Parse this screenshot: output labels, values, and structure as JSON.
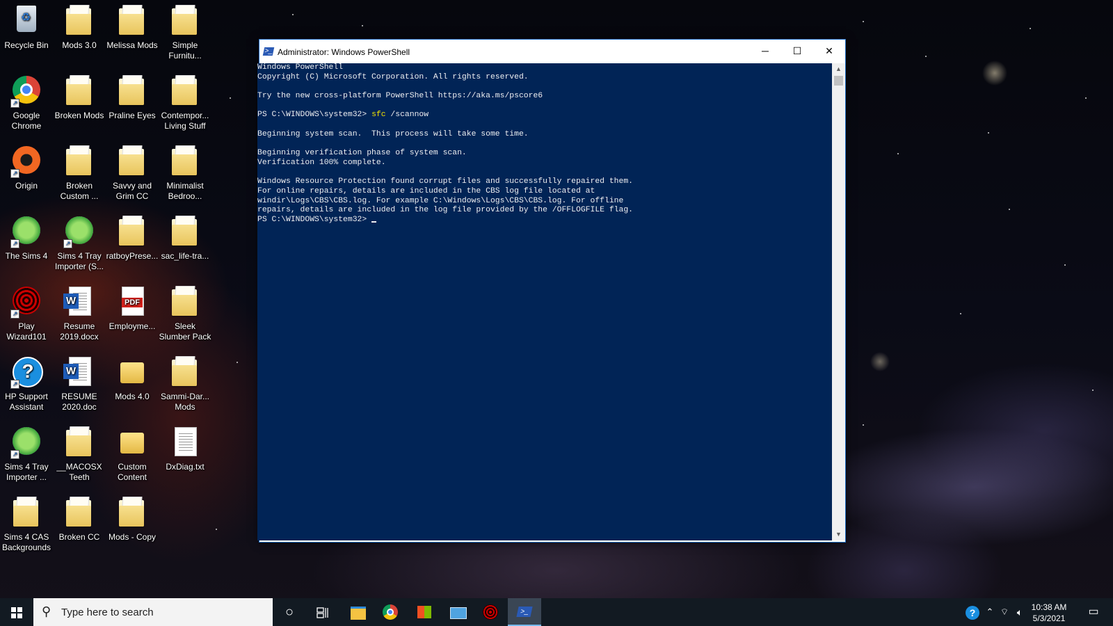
{
  "desktop": {
    "icons": [
      {
        "label": "Recycle Bin"
      },
      {
        "label": "Mods 3.0"
      },
      {
        "label": "Melissa Mods"
      },
      {
        "label": "Simple\nFurnitu..."
      },
      {
        "label": "Google\nChrome"
      },
      {
        "label": "Broken Mods"
      },
      {
        "label": "Praline Eyes"
      },
      {
        "label": "Contempor...\nLiving Stuff"
      },
      {
        "label": "Origin"
      },
      {
        "label": "Broken\nCustom ..."
      },
      {
        "label": "Savvy and\nGrim CC"
      },
      {
        "label": "Minimalist\nBedroo..."
      },
      {
        "label": "The Sims 4"
      },
      {
        "label": "Sims 4 Tray\nImporter (S..."
      },
      {
        "label": "ratboyPrese..."
      },
      {
        "label": "sac_life-tra..."
      },
      {
        "label": "Play\nWizard101"
      },
      {
        "label": "Resume\n2019.docx"
      },
      {
        "label": "Employme..."
      },
      {
        "label": "Sleek\nSlumber Pack"
      },
      {
        "label": "HP Support\nAssistant"
      },
      {
        "label": "RESUME\n2020.doc"
      },
      {
        "label": "Mods 4.0"
      },
      {
        "label": "Sammi-Dar...\nMods"
      },
      {
        "label": "Sims 4 Tray\nImporter ..."
      },
      {
        "label": "__MACOSX\nTeeth"
      },
      {
        "label": "Custom\nContent"
      },
      {
        "label": "DxDiag.txt"
      },
      {
        "label": "Sims 4 CAS\nBackgrounds"
      },
      {
        "label": "Broken CC"
      },
      {
        "label": "Mods - Copy"
      }
    ]
  },
  "window": {
    "title": "Administrator: Windows PowerShell",
    "minimize": "─",
    "maximize": "☐",
    "close": "✕"
  },
  "console": {
    "lines": [
      "Windows PowerShell",
      "Copyright (C) Microsoft Corporation. All rights reserved.",
      "",
      "Try the new cross-platform PowerShell https://aka.ms/pscore6",
      "",
      "PS C:\\WINDOWS\\system32> ",
      "",
      "Beginning system scan.  This process will take some time.",
      "",
      "Beginning verification phase of system scan.",
      "Verification 100% complete.",
      "",
      "Windows Resource Protection found corrupt files and successfully repaired them.",
      "For online repairs, details are included in the CBS log file located at",
      "windir\\Logs\\CBS\\CBS.log. For example C:\\Windows\\Logs\\CBS\\CBS.log. For offline",
      "repairs, details are included in the log file provided by the /OFFLOGFILE flag.",
      "PS C:\\WINDOWS\\system32> "
    ],
    "command_line_index": 5,
    "command": "sfc",
    "command_args": " /scannow",
    "prompt_line_index": 16
  },
  "taskbar": {
    "search_placeholder": "Type here to search",
    "time": "10:38 AM",
    "date": "5/3/2021"
  }
}
